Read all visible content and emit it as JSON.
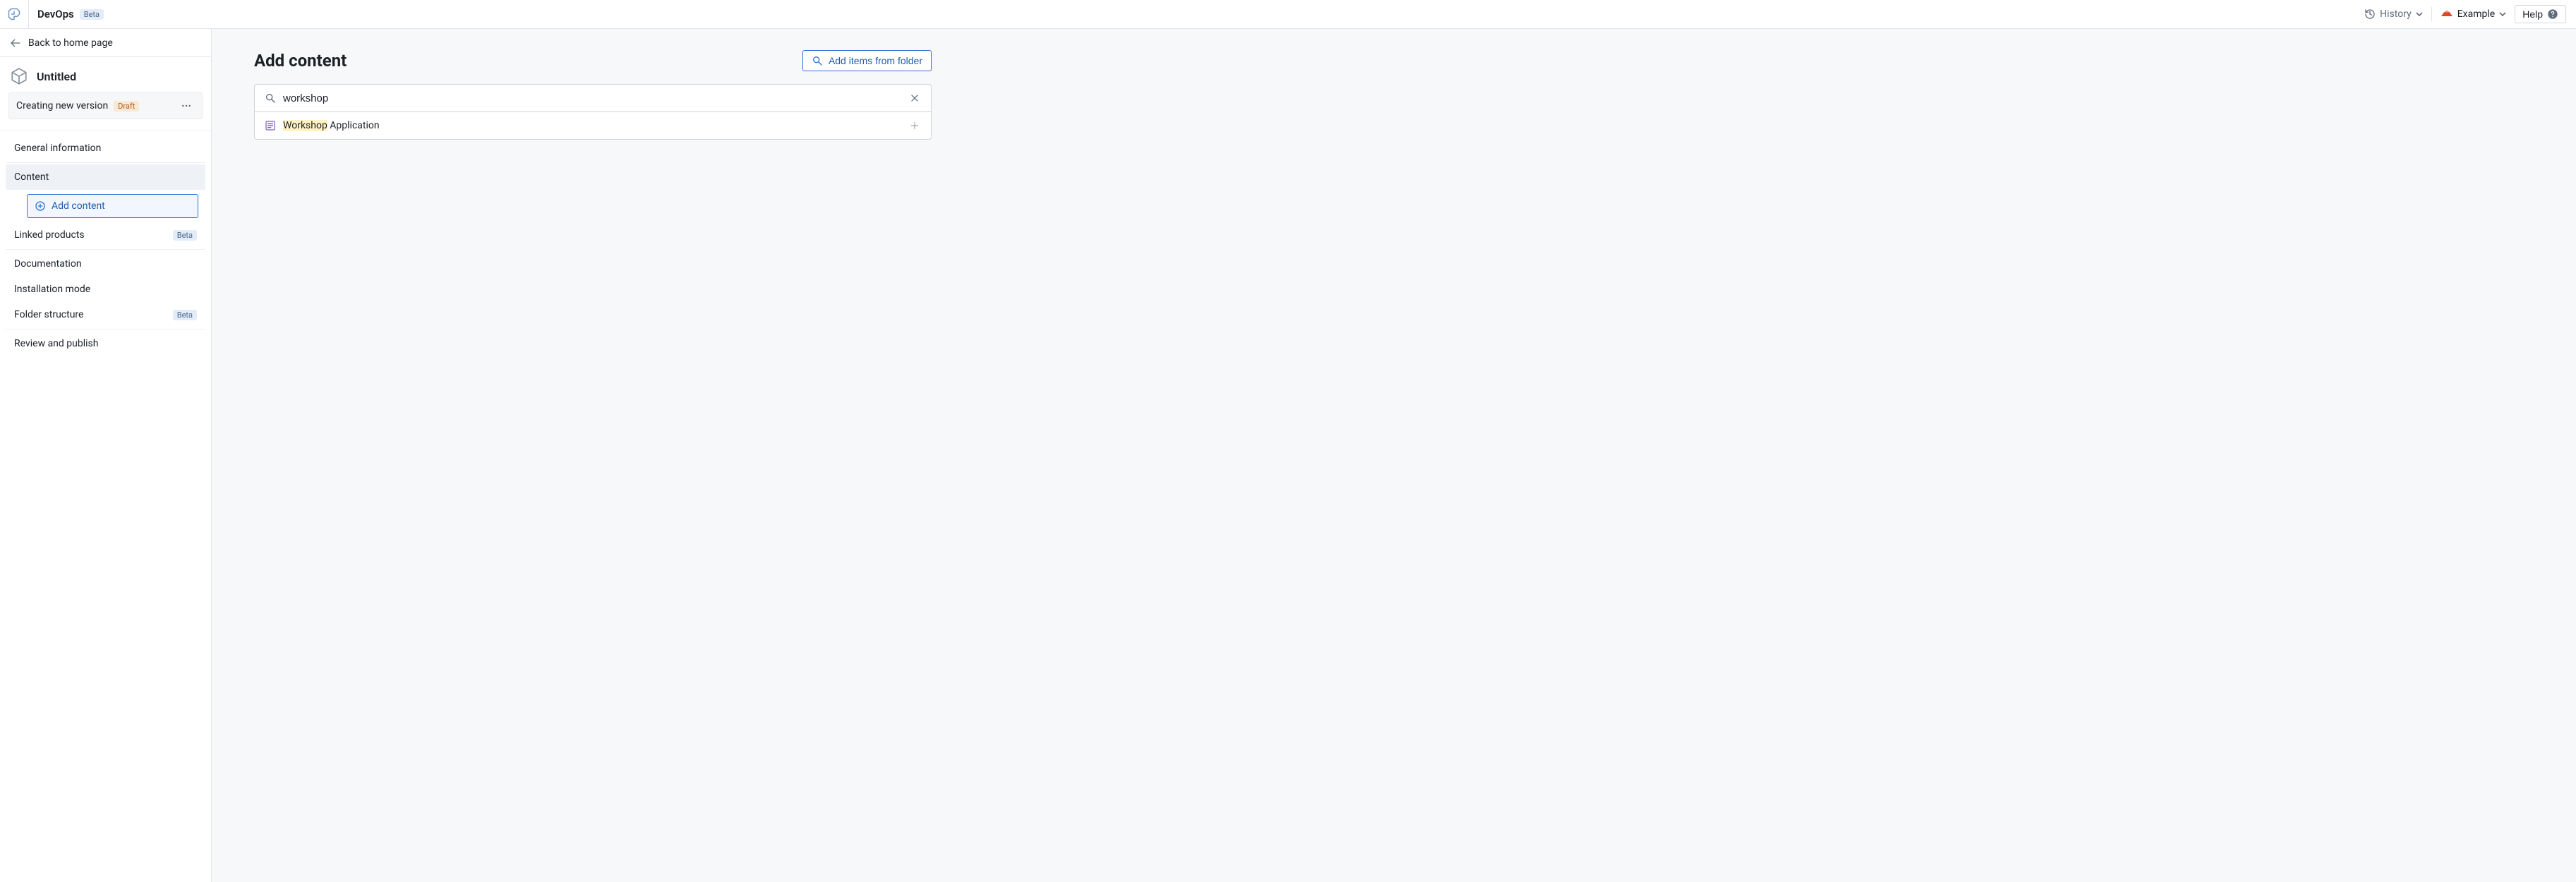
{
  "header": {
    "app_name": "DevOps",
    "beta_label": "Beta",
    "history_label": "History",
    "account_label": "Example",
    "help_label": "Help"
  },
  "sidebar": {
    "back_label": "Back to home page",
    "product_title": "Untitled",
    "version_label": "Creating new version",
    "draft_label": "Draft",
    "nav": {
      "general": "General information",
      "content": "Content",
      "add_content": "Add content",
      "linked_products": "Linked products",
      "linked_products_badge": "Beta",
      "documentation": "Documentation",
      "installation": "Installation mode",
      "folder_structure": "Folder structure",
      "folder_structure_badge": "Beta",
      "review": "Review and publish"
    }
  },
  "main": {
    "title": "Add content",
    "folder_button": "Add items from folder",
    "search_value": "workshop",
    "results": [
      {
        "match": "Workshop",
        "rest": " Application"
      }
    ]
  }
}
